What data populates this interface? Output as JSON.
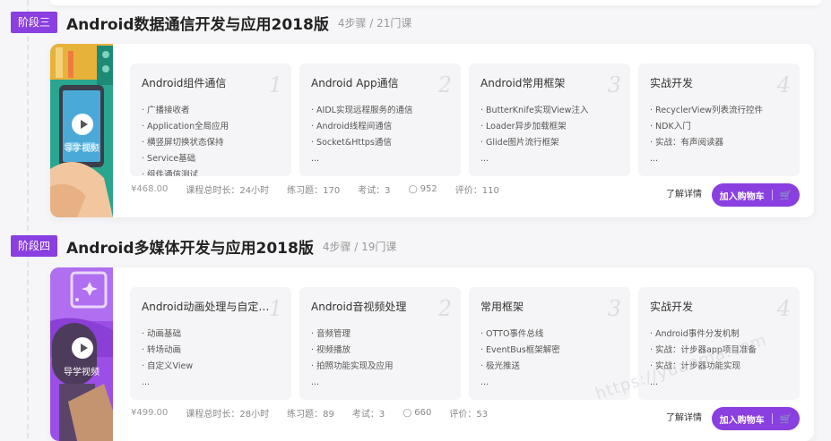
{
  "stages": [
    {
      "badge": "阶段三",
      "title": "Android数据通信开发与应用2018版",
      "meta": "4步骤 / 21门课",
      "thumb_label": "导学视频",
      "steps": [
        {
          "title": "Android组件通信",
          "num": "1",
          "items": [
            "· 广播接收者",
            "· Application全局应用",
            "· 横竖屏切换状态保持",
            "· Service基础",
            "· 组件通信测试"
          ]
        },
        {
          "title": "Android App通信",
          "num": "2",
          "items": [
            "· AIDL实现远程服务的通信",
            "· Android线程间通信",
            "· Socket&Https通信",
            "..."
          ]
        },
        {
          "title": "Android常用框架",
          "num": "3",
          "items": [
            "· ButterKnife实现View注入",
            "· Loader异步加载框架",
            "· Glide图片流行框架",
            "..."
          ]
        },
        {
          "title": "实战开发",
          "num": "4",
          "items": [
            "· RecyclerView列表流行控件",
            "· NDK入门",
            "· 实战：有声阅读器",
            "..."
          ]
        }
      ],
      "footer": {
        "price": "¥468.00",
        "duration": "课程总时长：24小时",
        "exercises": "练习题：170",
        "exams": "考试：3",
        "learners": "952",
        "rating": "评价：110"
      },
      "learn_more": "了解详情",
      "cart": "加入购物车",
      "theme_color": "#2aa58f"
    },
    {
      "badge": "阶段四",
      "title": "Android多媒体开发与应用2018版",
      "meta": "4步骤 / 19门课",
      "thumb_label": "导学视频",
      "steps": [
        {
          "title": "Android动画处理与自定义...",
          "num": "1",
          "items": [
            "· 动画基础",
            "· 转场动画",
            "· 自定义View",
            "..."
          ]
        },
        {
          "title": "Android音视频处理",
          "num": "2",
          "items": [
            "· 音频管理",
            "· 视频播放",
            "· 拍照功能实现及应用",
            "..."
          ]
        },
        {
          "title": "常用框架",
          "num": "3",
          "items": [
            "· OTTO事件总线",
            "· EventBus框架解密",
            "· 极光推送",
            "..."
          ]
        },
        {
          "title": "实战开发",
          "num": "4",
          "items": [
            "· Android事件分发机制",
            "· 实战：计步器app项目准备",
            "· 实战：计步器功能实现",
            "..."
          ]
        }
      ],
      "footer": {
        "price": "¥499.00",
        "duration": "课程总时长：28小时",
        "exercises": "练习题：89",
        "exams": "考试：3",
        "learners": "660",
        "rating": "评价：53"
      },
      "learn_more": "了解详情",
      "cart": "加入购物车",
      "theme_color": "#9b4fe6"
    }
  ],
  "watermark": "https://yuanma.com",
  "colors": {
    "accent": "#8a3fe0"
  }
}
